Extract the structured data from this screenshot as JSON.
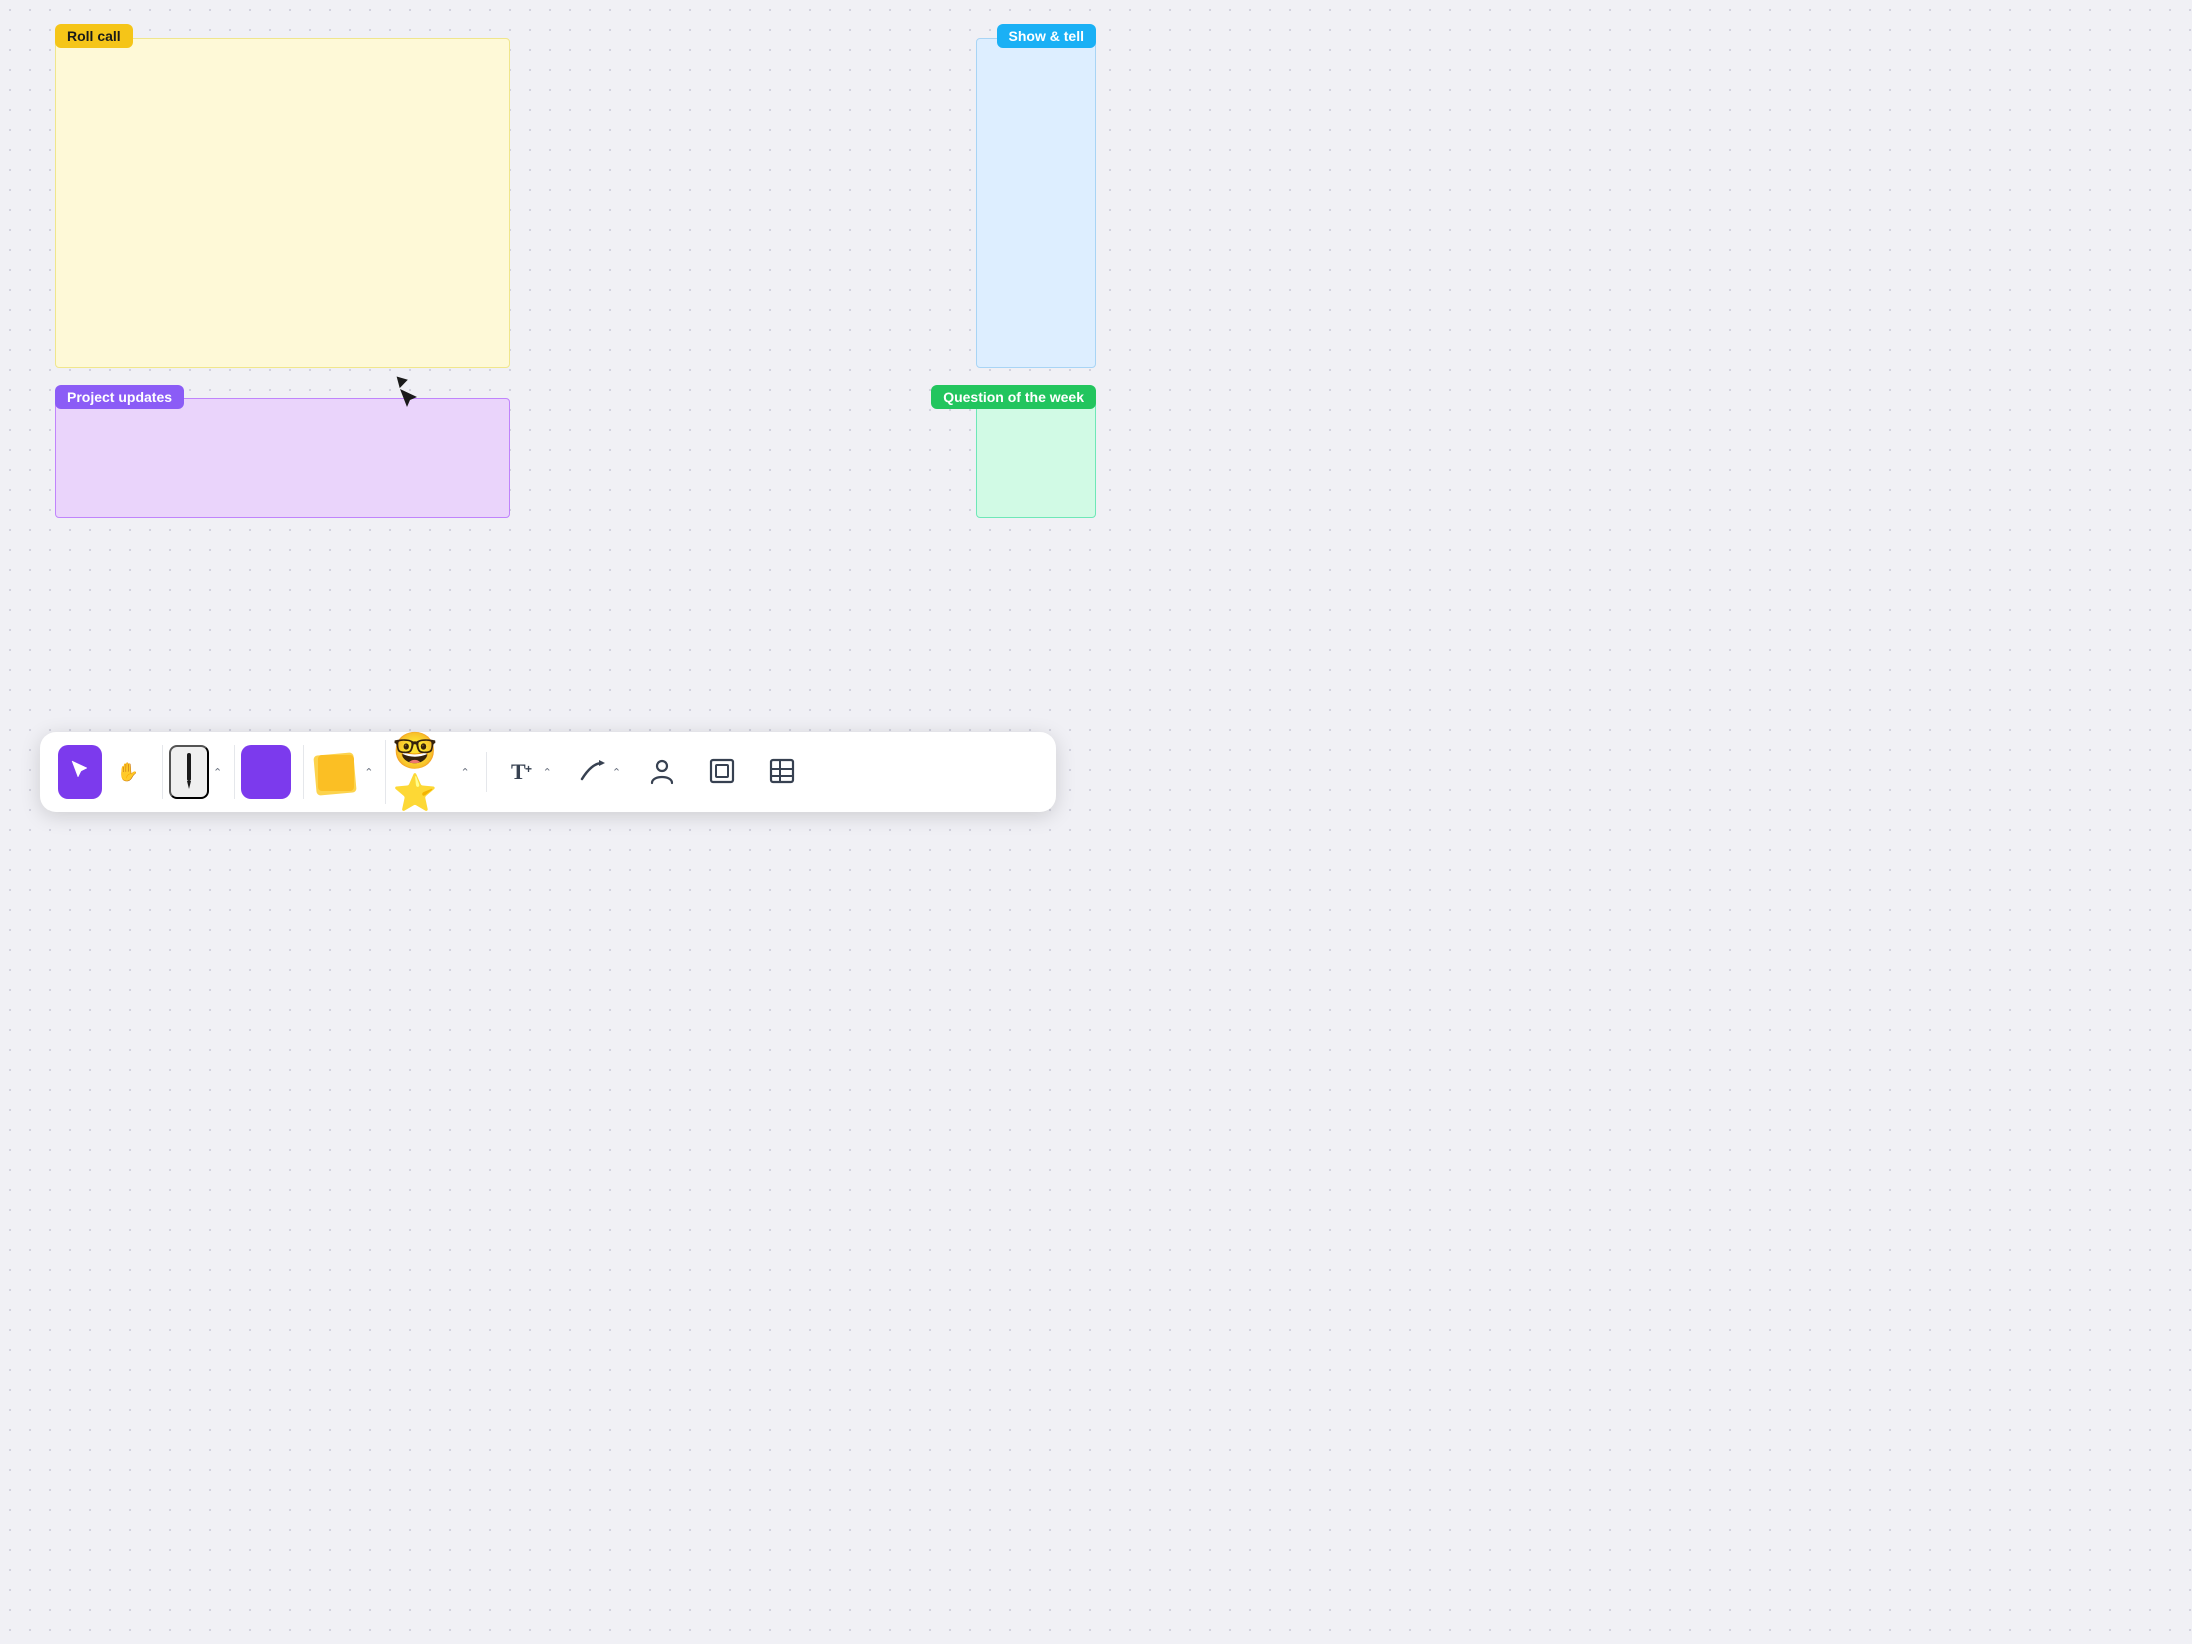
{
  "labels": {
    "roll_call": "Roll call",
    "show_tell": "Show & tell",
    "project_updates": "Project updates",
    "question_week": "Question of the week"
  },
  "colors": {
    "roll_call_bg": "#f5c518",
    "show_tell_bg": "#1ab0f5",
    "project_updates_bg": "#8b5cf6",
    "question_week_bg": "#22c55e",
    "canvas_bg": "#f0f0f5",
    "yellow_card": "#fef9d7",
    "blue_card": "#ddeeff",
    "purple_card": "#ead4fb",
    "green_card": "#d1fae5"
  },
  "toolbar": {
    "tools": [
      {
        "id": "cursor",
        "label": "Cursor",
        "icon": "▶"
      },
      {
        "id": "hand",
        "label": "Hand",
        "icon": "✋"
      }
    ]
  }
}
